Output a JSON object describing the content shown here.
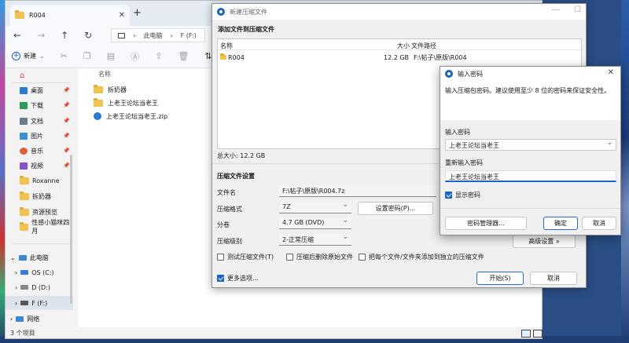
{
  "explorer": {
    "tab_title": "R004",
    "breadcrumb": [
      "此电脑",
      "F (F:)"
    ],
    "toolbar": {
      "new_label": "新建"
    },
    "column_header": "名称",
    "files": [
      {
        "name": "拆奶器",
        "icon": "folder-icon"
      },
      {
        "name": "上老王论坛当老王",
        "icon": "folder-icon"
      },
      {
        "name": "上老王论坛当老王.zip",
        "icon": "zip-icon"
      }
    ],
    "quick_access": [
      {
        "label": "桌面",
        "color": "#2b7bd4"
      },
      {
        "label": "下载",
        "color": "#2b9c5a"
      },
      {
        "label": "文档",
        "color": "#6b7b8c"
      },
      {
        "label": "图片",
        "color": "#3a8fd8"
      },
      {
        "label": "音乐",
        "color": "#e0603a"
      },
      {
        "label": "视频",
        "color": "#8a4fd0"
      },
      {
        "label": "Roxanne",
        "color": "#f2c14e"
      },
      {
        "label": "拆奶器",
        "color": "#f2c14e"
      },
      {
        "label": "资源预览",
        "color": "#f2c14e"
      },
      {
        "label": "性感小猫咪四月",
        "color": "#f2c14e"
      }
    ],
    "this_pc": {
      "label": "此电脑",
      "drives": [
        {
          "label": "OS (C:)"
        },
        {
          "label": "D (D:)"
        },
        {
          "label": "F (F:)"
        }
      ]
    },
    "network": "网络",
    "status": "3 个项目"
  },
  "archive_dialog": {
    "title": "新建压缩文件",
    "add_heading": "添加文件到压缩文件",
    "columns": {
      "name": "名称",
      "size": "大小",
      "path": "文件路径"
    },
    "rows": [
      {
        "name": "R004",
        "size": "12.2 GB",
        "path": "F:\\帖子\\原版\\R004"
      }
    ],
    "total_size": "总大小: 12.2 GB",
    "settings_heading": "压缩文件设置",
    "filename_label": "文件名",
    "filename_value": "F:\\帖子\\原版\\R004.7z",
    "format_label": "压缩格式",
    "format_value": "7Z",
    "volume_label": "分卷",
    "volume_value": "4.7 GB (DVD)",
    "level_label": "压缩级别",
    "level_value": "2-正常压缩",
    "set_password_button": "设置密码(P)...",
    "advanced_button": "高级设置 »",
    "test_label": "测试压缩文件(T)",
    "delete_label": "压缩后删除原始文件",
    "separate_label": "把每个文件/文件夹添加到独立的压缩文件",
    "more_options_label": "更多选项...",
    "start_button": "开始(S)",
    "cancel_button": "取消"
  },
  "password_dialog": {
    "title": "输入密码",
    "hint": "输入压缩包密码。建议使用至少 8 位的密码来保证安全性。",
    "password_label": "输入密码",
    "password_value": "上老王论坛当老王",
    "reenter_label": "重新输入密码",
    "reenter_value": "上老王论坛当老王",
    "show_password_label": "显示密码",
    "manager_button": "密码管理器...",
    "ok_button": "确定",
    "cancel_button": "取消"
  }
}
